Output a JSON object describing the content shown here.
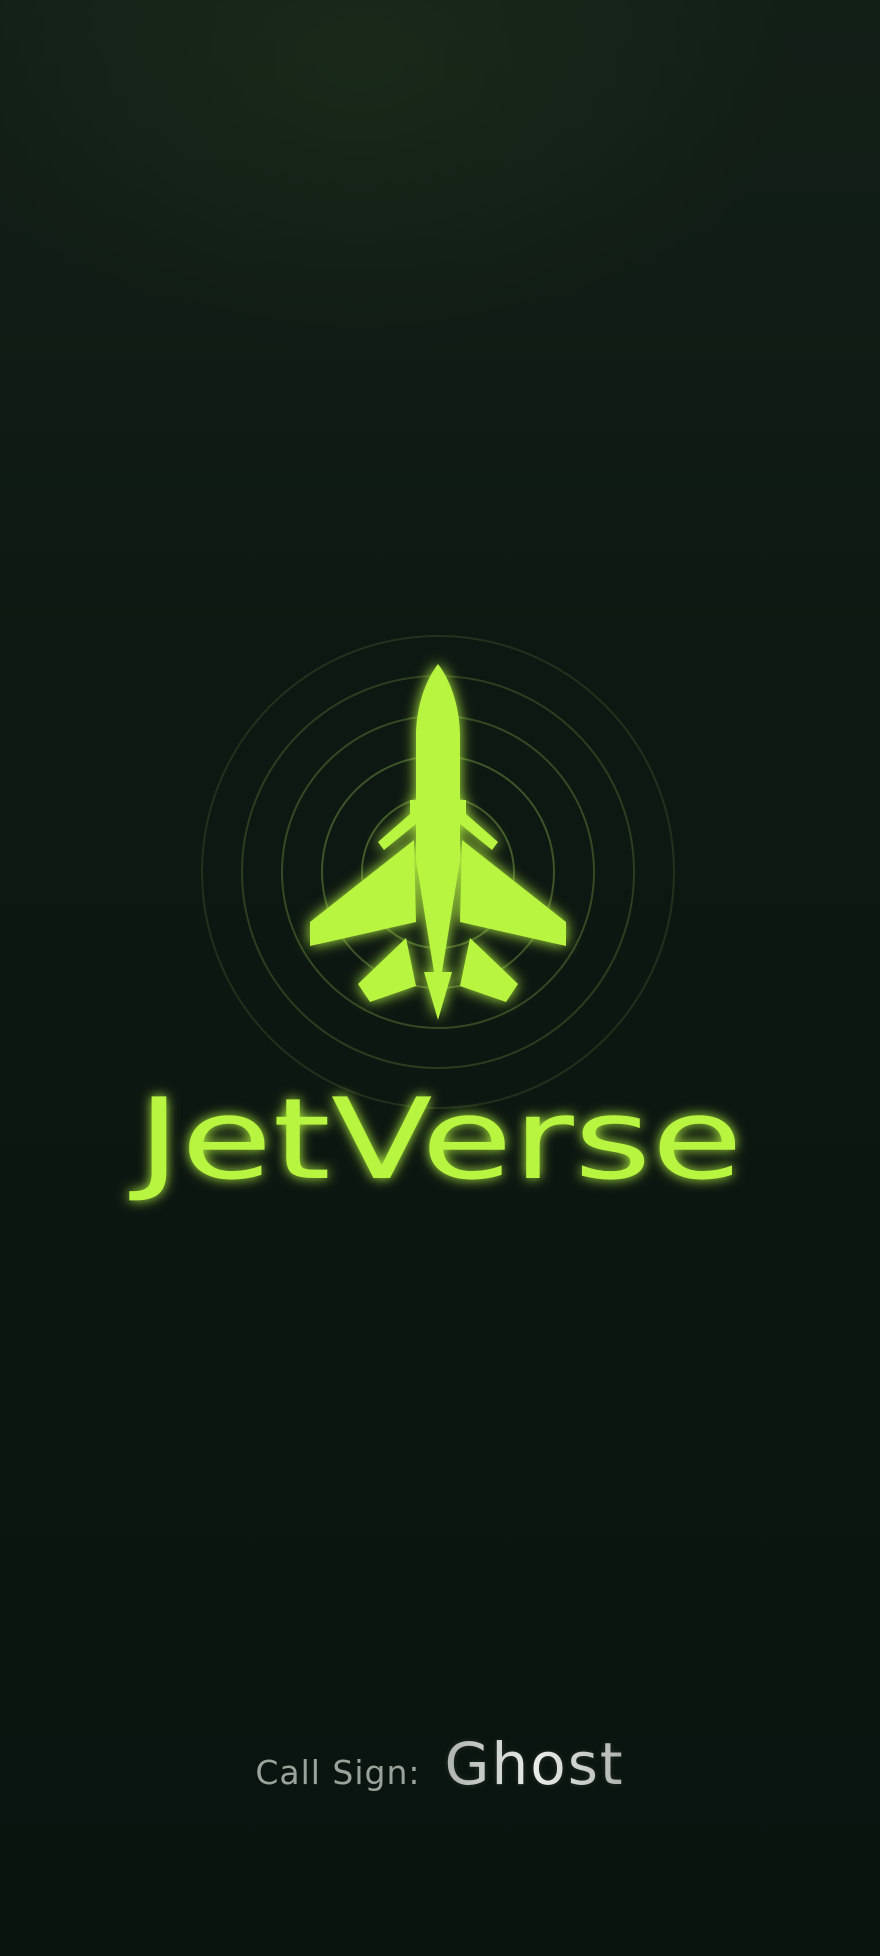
{
  "app": {
    "title": "JetVerse"
  },
  "brand": {
    "accent_color": "#b8f53f",
    "ring_color": "#6e8f3f",
    "emblem_icon": "fighter-jet-icon"
  },
  "player": {
    "call_sign_label": "Call Sign:",
    "call_sign_value": "Ghost"
  }
}
